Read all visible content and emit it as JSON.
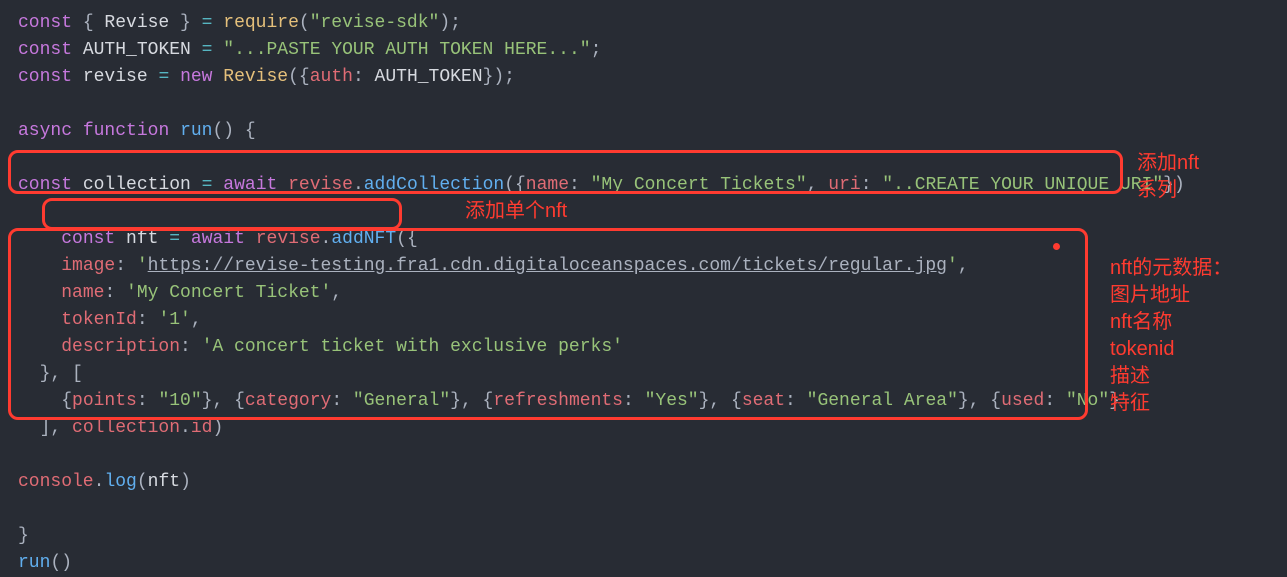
{
  "code": {
    "lines": [
      {
        "indent": "",
        "tokens": [
          [
            "kw",
            "const"
          ],
          [
            "punc",
            " { "
          ],
          [
            "white",
            "Revise"
          ],
          [
            "punc",
            " } "
          ],
          [
            "op",
            "="
          ],
          [
            "punc",
            " "
          ],
          [
            "yel",
            "require"
          ],
          [
            "punc",
            "("
          ],
          [
            "str",
            "\"revise-sdk\""
          ],
          [
            "punc",
            ");"
          ]
        ]
      },
      {
        "indent": "",
        "tokens": [
          [
            "kw",
            "const"
          ],
          [
            "punc",
            " "
          ],
          [
            "white",
            "AUTH_TOKEN"
          ],
          [
            "punc",
            " "
          ],
          [
            "op",
            "="
          ],
          [
            "punc",
            " "
          ],
          [
            "str",
            "\"...PASTE YOUR AUTH TOKEN HERE...\""
          ],
          [
            "punc",
            ";"
          ]
        ]
      },
      {
        "indent": "",
        "tokens": [
          [
            "kw",
            "const"
          ],
          [
            "punc",
            " "
          ],
          [
            "white",
            "revise"
          ],
          [
            "punc",
            " "
          ],
          [
            "op",
            "="
          ],
          [
            "punc",
            " "
          ],
          [
            "kw",
            "new"
          ],
          [
            "punc",
            " "
          ],
          [
            "yel",
            "Revise"
          ],
          [
            "punc",
            "({"
          ],
          [
            "prop",
            "auth"
          ],
          [
            "punc",
            ": "
          ],
          [
            "white",
            "AUTH_TOKEN"
          ],
          [
            "punc",
            "});"
          ]
        ]
      },
      {
        "indent": "",
        "tokens": [
          [
            "punc",
            ""
          ]
        ]
      },
      {
        "indent": "",
        "tokens": [
          [
            "kw",
            "async"
          ],
          [
            "punc",
            " "
          ],
          [
            "kw",
            "function"
          ],
          [
            "punc",
            " "
          ],
          [
            "fn",
            "run"
          ],
          [
            "punc",
            "() {"
          ]
        ]
      },
      {
        "indent": "",
        "tokens": [
          [
            "punc",
            ""
          ]
        ]
      },
      {
        "indent": "",
        "tokens": [
          [
            "kw",
            "const"
          ],
          [
            "punc",
            " "
          ],
          [
            "white",
            "collection"
          ],
          [
            "punc",
            " "
          ],
          [
            "op",
            "="
          ],
          [
            "punc",
            " "
          ],
          [
            "kw",
            "await"
          ],
          [
            "punc",
            " "
          ],
          [
            "var",
            "revise"
          ],
          [
            "punc",
            "."
          ],
          [
            "fn",
            "addCollection"
          ],
          [
            "punc",
            "({"
          ],
          [
            "prop",
            "name"
          ],
          [
            "punc",
            ": "
          ],
          [
            "str",
            "\"My Concert Tickets\""
          ],
          [
            "punc",
            ", "
          ],
          [
            "prop",
            "uri"
          ],
          [
            "punc",
            ": "
          ],
          [
            "str",
            "\"..CREATE YOUR UNIQUE URI\""
          ],
          [
            "punc",
            "})"
          ]
        ]
      },
      {
        "indent": "",
        "tokens": [
          [
            "punc",
            ""
          ]
        ]
      },
      {
        "indent": "    ",
        "tokens": [
          [
            "kw",
            "const"
          ],
          [
            "punc",
            " "
          ],
          [
            "white",
            "nft"
          ],
          [
            "punc",
            " "
          ],
          [
            "op",
            "="
          ],
          [
            "punc",
            " "
          ],
          [
            "kw",
            "await"
          ],
          [
            "punc",
            " "
          ],
          [
            "var",
            "revise"
          ],
          [
            "punc",
            "."
          ],
          [
            "fn",
            "addNFT"
          ],
          [
            "punc",
            "({"
          ]
        ]
      },
      {
        "indent": "    ",
        "tokens": [
          [
            "prop",
            "image"
          ],
          [
            "punc",
            ": "
          ],
          [
            "str",
            "'"
          ],
          [
            "url",
            "https://revise-testing.fra1.cdn.digitaloceanspaces.com/tickets/regular.jpg"
          ],
          [
            "str",
            "'"
          ],
          [
            "punc",
            ","
          ]
        ]
      },
      {
        "indent": "    ",
        "tokens": [
          [
            "prop",
            "name"
          ],
          [
            "punc",
            ": "
          ],
          [
            "str",
            "'My Concert Ticket'"
          ],
          [
            "punc",
            ","
          ]
        ]
      },
      {
        "indent": "    ",
        "tokens": [
          [
            "prop",
            "tokenId"
          ],
          [
            "punc",
            ": "
          ],
          [
            "str",
            "'1'"
          ],
          [
            "punc",
            ","
          ]
        ]
      },
      {
        "indent": "    ",
        "tokens": [
          [
            "prop",
            "description"
          ],
          [
            "punc",
            ": "
          ],
          [
            "str",
            "'A concert ticket with exclusive perks'"
          ]
        ]
      },
      {
        "indent": "  ",
        "tokens": [
          [
            "punc",
            "}, ["
          ]
        ]
      },
      {
        "indent": "    ",
        "tokens": [
          [
            "punc",
            "{"
          ],
          [
            "prop",
            "points"
          ],
          [
            "punc",
            ": "
          ],
          [
            "str",
            "\"10\""
          ],
          [
            "punc",
            "}, {"
          ],
          [
            "prop",
            "category"
          ],
          [
            "punc",
            ": "
          ],
          [
            "str",
            "\"General\""
          ],
          [
            "punc",
            "}, {"
          ],
          [
            "prop",
            "refreshments"
          ],
          [
            "punc",
            ": "
          ],
          [
            "str",
            "\"Yes\""
          ],
          [
            "punc",
            "}, {"
          ],
          [
            "prop",
            "seat"
          ],
          [
            "punc",
            ": "
          ],
          [
            "str",
            "\"General Area\""
          ],
          [
            "punc",
            "}, {"
          ],
          [
            "prop",
            "used"
          ],
          [
            "punc",
            ": "
          ],
          [
            "str",
            "\"No\""
          ],
          [
            "punc",
            "}"
          ]
        ]
      },
      {
        "indent": "  ",
        "tokens": [
          [
            "punc",
            "], "
          ],
          [
            "var",
            "collection"
          ],
          [
            "punc",
            "."
          ],
          [
            "var",
            "id"
          ],
          [
            "punc",
            ")"
          ]
        ]
      },
      {
        "indent": "",
        "tokens": [
          [
            "punc",
            ""
          ]
        ]
      },
      {
        "indent": "",
        "tokens": [
          [
            "var",
            "console"
          ],
          [
            "punc",
            "."
          ],
          [
            "fn",
            "log"
          ],
          [
            "punc",
            "("
          ],
          [
            "white",
            "nft"
          ],
          [
            "punc",
            ")"
          ]
        ]
      },
      {
        "indent": "",
        "tokens": [
          [
            "punc",
            ""
          ]
        ]
      },
      {
        "indent": "",
        "tokens": [
          [
            "punc",
            "}"
          ]
        ]
      },
      {
        "indent": "",
        "tokens": [
          [
            "fn",
            "run"
          ],
          [
            "punc",
            "()"
          ]
        ]
      }
    ]
  },
  "annotations": {
    "right1": "添加nft\n系列",
    "mid": "添加单个nft",
    "right2": "nft的元数据：\n图片地址\nnft名称\ntokenid\n描述\n特征"
  }
}
